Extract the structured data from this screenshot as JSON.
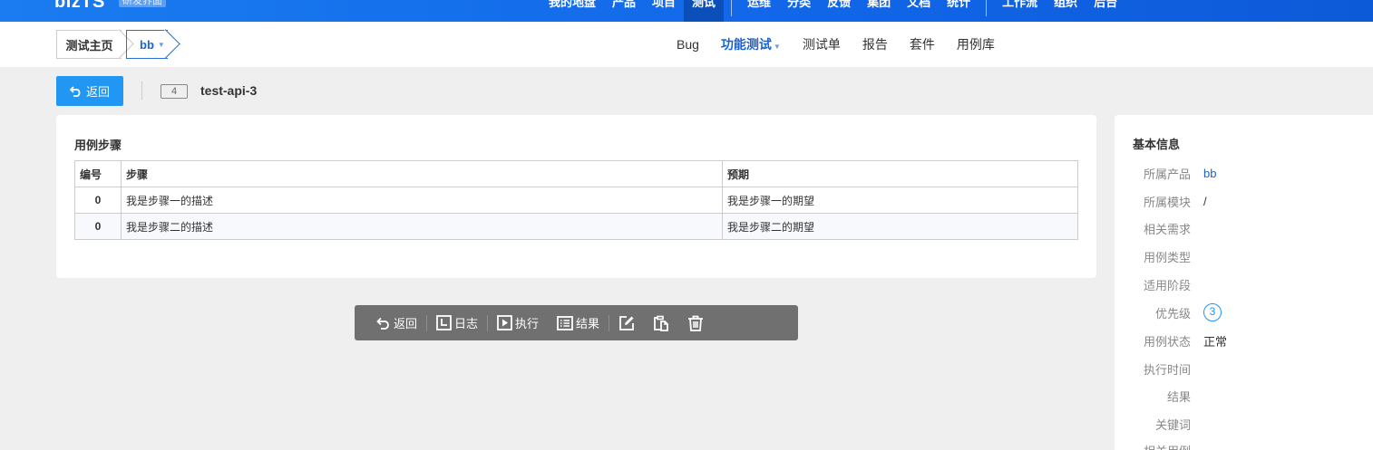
{
  "topbar": {
    "brand": "bizTS",
    "version": "研发界面",
    "nav": [
      "我的地盘",
      "产品",
      "项目",
      "测试",
      "运维",
      "分类",
      "反馈",
      "集团",
      "文档",
      "统计",
      "工作流",
      "组织",
      "后台"
    ],
    "active_nav": "测试"
  },
  "breadcrumb": {
    "home": "测试主页",
    "product": "bb"
  },
  "subnav": {
    "items": [
      "Bug",
      "功能测试",
      "测试单",
      "报告",
      "套件",
      "用例库"
    ],
    "active": "功能测试"
  },
  "header": {
    "back_label": "返回",
    "case_id": "4",
    "case_title": "test-api-3"
  },
  "steps": {
    "title": "用例步骤",
    "columns": [
      "编号",
      "步骤",
      "预期"
    ],
    "rows": [
      {
        "num": "0",
        "step": "我是步骤一的描述",
        "expect": "我是步骤一的期望"
      },
      {
        "num": "0",
        "step": "我是步骤二的描述",
        "expect": "我是步骤二的期望"
      }
    ]
  },
  "toolbar": {
    "back": "返回",
    "log": "日志",
    "run": "执行",
    "result": "结果"
  },
  "info": {
    "title": "基本信息",
    "fields": [
      {
        "label": "所属产品",
        "value": "bb"
      },
      {
        "label": "所属模块",
        "value": "/"
      },
      {
        "label": "相关需求",
        "value": ""
      },
      {
        "label": "用例类型",
        "value": ""
      },
      {
        "label": "适用阶段",
        "value": ""
      },
      {
        "label": "优先级",
        "value": "3"
      },
      {
        "label": "用例状态",
        "value": "正常"
      },
      {
        "label": "执行时间",
        "value": ""
      },
      {
        "label": "结果",
        "value": ""
      },
      {
        "label": "关键词",
        "value": ""
      },
      {
        "label": "相关用例",
        "value": ""
      }
    ]
  },
  "colors": {
    "primary": "#2196f3",
    "topbar": "#1166e8",
    "link": "#1a62d4",
    "toolbar": "#707070"
  }
}
